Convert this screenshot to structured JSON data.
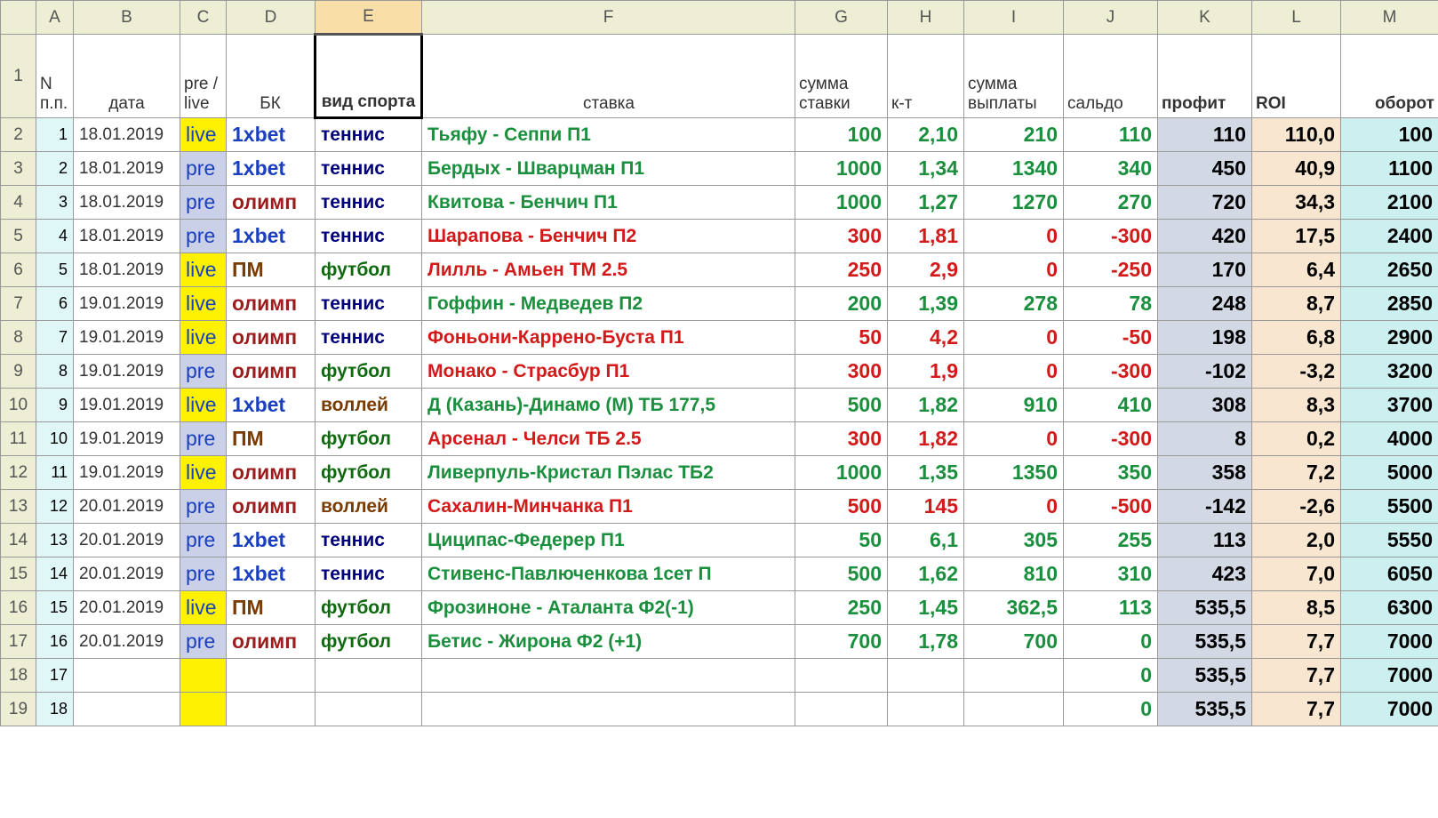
{
  "columns": [
    "A",
    "B",
    "C",
    "D",
    "E",
    "F",
    "G",
    "H",
    "I",
    "J",
    "K",
    "L",
    "M"
  ],
  "col_widths": {
    "corner": 40,
    "A": 42,
    "B": 120,
    "C": 52,
    "D": 100,
    "E": 120,
    "F": 420,
    "G": 104,
    "H": 86,
    "I": 112,
    "J": 106,
    "K": 106,
    "L": 100,
    "M": 110
  },
  "selected_column": "E",
  "headers": {
    "A": "N п.п.",
    "B": "дата",
    "C": "pre / live",
    "D": "БК",
    "E": "вид спорта",
    "F": "ставка",
    "G": "сумма ставки",
    "H": "к-т",
    "I": "сумма выплаты",
    "J": "сальдо",
    "K": "профит",
    "L": "ROI",
    "M": "оборот"
  },
  "rows": [
    {
      "n": 1,
      "date": "18.01.2019",
      "mode": "live",
      "bk": "1xbet",
      "sport": "теннис",
      "bet": "Тьяфу - Сеппи П1",
      "result": "win",
      "stake": "100",
      "odds": "2,10",
      "payout": "210",
      "saldo": "110",
      "profit": "110",
      "roi": "110,0",
      "turn": "100"
    },
    {
      "n": 2,
      "date": "18.01.2019",
      "mode": "pre",
      "bk": "1xbet",
      "sport": "теннис",
      "bet": "Бердых - Шварцман П1",
      "result": "win",
      "stake": "1000",
      "odds": "1,34",
      "payout": "1340",
      "saldo": "340",
      "profit": "450",
      "roi": "40,9",
      "turn": "1100"
    },
    {
      "n": 3,
      "date": "18.01.2019",
      "mode": "pre",
      "bk": "олимп",
      "sport": "теннис",
      "bet": "Квитова - Бенчич П1",
      "result": "win",
      "stake": "1000",
      "odds": "1,27",
      "payout": "1270",
      "saldo": "270",
      "profit": "720",
      "roi": "34,3",
      "turn": "2100"
    },
    {
      "n": 4,
      "date": "18.01.2019",
      "mode": "pre",
      "bk": "1xbet",
      "sport": "теннис",
      "bet": "Шарапова - Бенчич П2",
      "result": "loss",
      "stake": "300",
      "odds": "1,81",
      "payout": "0",
      "saldo": "-300",
      "profit": "420",
      "roi": "17,5",
      "turn": "2400"
    },
    {
      "n": 5,
      "date": "18.01.2019",
      "mode": "live",
      "bk": "ПМ",
      "sport": "футбол",
      "bet": "Лилль - Амьен ТМ 2.5",
      "result": "loss",
      "stake": "250",
      "odds": "2,9",
      "payout": "0",
      "saldo": "-250",
      "profit": "170",
      "roi": "6,4",
      "turn": "2650"
    },
    {
      "n": 6,
      "date": "19.01.2019",
      "mode": "live",
      "bk": "олимп",
      "sport": "теннис",
      "bet": "Гоффин - Медведев П2",
      "result": "win",
      "stake": "200",
      "odds": "1,39",
      "payout": "278",
      "saldo": "78",
      "profit": "248",
      "roi": "8,7",
      "turn": "2850"
    },
    {
      "n": 7,
      "date": "19.01.2019",
      "mode": "live",
      "bk": "олимп",
      "sport": "теннис",
      "bet": "Фоньони-Каррено-Буста П1",
      "result": "loss",
      "stake": "50",
      "odds": "4,2",
      "payout": "0",
      "saldo": "-50",
      "profit": "198",
      "roi": "6,8",
      "turn": "2900"
    },
    {
      "n": 8,
      "date": "19.01.2019",
      "mode": "pre",
      "bk": "олимп",
      "sport": "футбол",
      "bet": "Монако - Страсбур П1",
      "result": "loss",
      "stake": "300",
      "odds": "1,9",
      "payout": "0",
      "saldo": "-300",
      "profit": "-102",
      "roi": "-3,2",
      "turn": "3200"
    },
    {
      "n": 9,
      "date": "19.01.2019",
      "mode": "live",
      "bk": "1xbet",
      "sport": "воллей",
      "bet": "Д (Казань)-Динамо (М) ТБ 177,5",
      "result": "win",
      "stake": "500",
      "odds": "1,82",
      "payout": "910",
      "saldo": "410",
      "profit": "308",
      "roi": "8,3",
      "turn": "3700"
    },
    {
      "n": 10,
      "date": "19.01.2019",
      "mode": "pre",
      "bk": "ПМ",
      "sport": "футбол",
      "bet": "Арсенал - Челси ТБ 2.5",
      "result": "loss",
      "stake": "300",
      "odds": "1,82",
      "payout": "0",
      "saldo": "-300",
      "profit": "8",
      "roi": "0,2",
      "turn": "4000"
    },
    {
      "n": 11,
      "date": "19.01.2019",
      "mode": "live",
      "bk": "олимп",
      "sport": "футбол",
      "bet": "Ливерпуль-Кристал Пэлас ТБ2",
      "result": "win",
      "stake": "1000",
      "odds": "1,35",
      "payout": "1350",
      "saldo": "350",
      "profit": "358",
      "roi": "7,2",
      "turn": "5000"
    },
    {
      "n": 12,
      "date": "20.01.2019",
      "mode": "pre",
      "bk": "олимп",
      "sport": "воллей",
      "bet": "Сахалин-Минчанка П1",
      "result": "loss",
      "stake": "500",
      "odds": "145",
      "payout": "0",
      "saldo": "-500",
      "profit": "-142",
      "roi": "-2,6",
      "turn": "5500"
    },
    {
      "n": 13,
      "date": "20.01.2019",
      "mode": "pre",
      "bk": "1xbet",
      "sport": "теннис",
      "bet": "Циципас-Федерер П1",
      "result": "win",
      "stake": "50",
      "odds": "6,1",
      "payout": "305",
      "saldo": "255",
      "profit": "113",
      "roi": "2,0",
      "turn": "5550"
    },
    {
      "n": 14,
      "date": "20.01.2019",
      "mode": "pre",
      "bk": "1xbet",
      "sport": "теннис",
      "bet": "Стивенс-Павлюченкова 1сет П",
      "result": "win",
      "stake": "500",
      "odds": "1,62",
      "payout": "810",
      "saldo": "310",
      "profit": "423",
      "roi": "7,0",
      "turn": "6050"
    },
    {
      "n": 15,
      "date": "20.01.2019",
      "mode": "live",
      "bk": "ПМ",
      "sport": "футбол",
      "bet": "Фрозиноне - Аталанта Ф2(-1)",
      "result": "win",
      "stake": "250",
      "odds": "1,45",
      "payout": "362,5",
      "saldo": "113",
      "profit": "535,5",
      "roi": "8,5",
      "turn": "6300"
    },
    {
      "n": 16,
      "date": "20.01.2019",
      "mode": "pre",
      "bk": "олимп",
      "sport": "футбол",
      "bet": "Бетис - Жирона Ф2 (+1)",
      "result": "win",
      "stake": "700",
      "odds": "1,78",
      "payout": "700",
      "saldo": "0",
      "profit": "535,5",
      "roi": "7,7",
      "turn": "7000"
    }
  ],
  "empty_rows": [
    {
      "n": 17,
      "saldo": "0",
      "profit": "535,5",
      "roi": "7,7",
      "turn": "7000"
    },
    {
      "n": 18,
      "saldo": "0",
      "profit": "535,5",
      "roi": "7,7",
      "turn": "7000"
    }
  ],
  "bk_colors": {
    "1xbet": "t-blue",
    "олимп": "t-darkred",
    "ПМ": "t-brown"
  },
  "sport_colors": {
    "теннис": "t-darkblue",
    "футбол": "t-darkgreen",
    "воллей": "t-brown"
  }
}
